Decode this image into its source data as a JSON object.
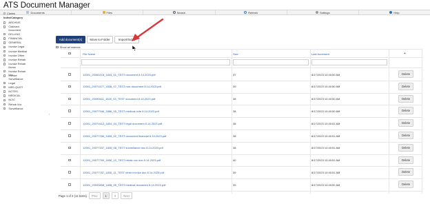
{
  "app": {
    "title": "ATS Document Manager"
  },
  "nav": [
    {
      "label": "Documents",
      "icon": "documents-icon"
    },
    {
      "label": "Files",
      "icon": "folder-icon"
    },
    {
      "label": "Search",
      "icon": "search-icon"
    },
    {
      "label": "Refresh",
      "icon": "refresh-icon"
    },
    {
      "label": "Settings",
      "icon": "settings-icon"
    },
    {
      "label": "Help",
      "icon": "help-icon"
    }
  ],
  "sidebar": {
    "claims_label": "Claims",
    "heading": "Index/Category",
    "items": [
      {
        "label": "ARCHIVE"
      },
      {
        "label": "Claimant Document"
      },
      {
        "label": "DELLING"
      },
      {
        "label": "FINANCIAL"
      },
      {
        "label": "GENERAL"
      },
      {
        "label": "Invoice Legal"
      },
      {
        "label": "Invoice Medical"
      },
      {
        "label": "Invoice Other"
      },
      {
        "label": "Invoice Rehab"
      },
      {
        "label": "Invoice Rehab Nurse"
      },
      {
        "label": "Invoice Rehab Voc"
      },
      {
        "label": "Invoice Surveillance"
      },
      {
        "label": "Legal"
      },
      {
        "label": "MED QUOT"
      },
      {
        "label": "NOTES"
      },
      {
        "label": "MEDICAL"
      },
      {
        "label": "NCIC"
      },
      {
        "label": "Rehab Voc"
      },
      {
        "label": "Surveillance"
      }
    ]
  },
  "toolbar": {
    "add_label": "Add document(s)",
    "move_label": "Move to Folder",
    "import_label": "Import/Index",
    "show_all_label": "Show all indexes"
  },
  "table": {
    "columns": {
      "name": "File Name",
      "size": "Size",
      "date": "Last Accessed"
    },
    "add_column_symbol": "+",
    "delete_label": "Delete",
    "rows": [
      {
        "name": "12001_20060215_1604_01_TEST document 8.14.2023.pdf",
        "size": "37",
        "date": "8/17/2023 10:40:50 AM"
      },
      {
        "name": "12001_20071577_1836_07_TEST ncic document 8.14.2023.pdf",
        "size": "39",
        "date": "8/17/2023 10:40:50 AM"
      },
      {
        "name": "12001_20090611_1826_03_TEST document 8.14.2023.pdf",
        "size": "38",
        "date": "8/17/2023 10:40:50 AM"
      },
      {
        "name": "12001_20077946_1886_05_TEST medical note 8.14.2023.pdf",
        "size": "38",
        "date": "8/17/2023 10:40:50 AM"
      },
      {
        "name": "12001_20071612_1804_04_TEST legal document 8.14.2023.pdf",
        "size": "38",
        "date": "8/17/2023 10:40:51 AM"
      },
      {
        "name": "12001_20077256_1806_02_TEST document financial 8.14.2023.pdf",
        "size": "38",
        "date": "8/17/2023 10:40:51 AM"
      },
      {
        "name": "12001_20077157_1830_08_TEST surveillance doc 8.14.2023.pdf",
        "size": "38",
        "date": "8/17/2023 10:40:51 AM"
      },
      {
        "name": "12001_20077769_1830_10_TEST rehab voc doc 8.14.2023.pdf",
        "size": "40",
        "date": "8/17/2023 10:40:51 AM"
      },
      {
        "name": "12001_20077787_1830_11_TEST other invoice doc 8.14.2023.pdf",
        "size": "39",
        "date": "8/17/2023 10:40:51 AM"
      },
      {
        "name": "12001_20093808_1838_06_TEST medical document 8.14.2023.pdf",
        "size": "39",
        "date": "8/17/2023 10:40:52 AM"
      }
    ]
  },
  "pager": {
    "summary": "Page 1 of 2 (11 items)",
    "prev": "Prev",
    "pages": [
      "1",
      "2"
    ],
    "next": "Next"
  }
}
